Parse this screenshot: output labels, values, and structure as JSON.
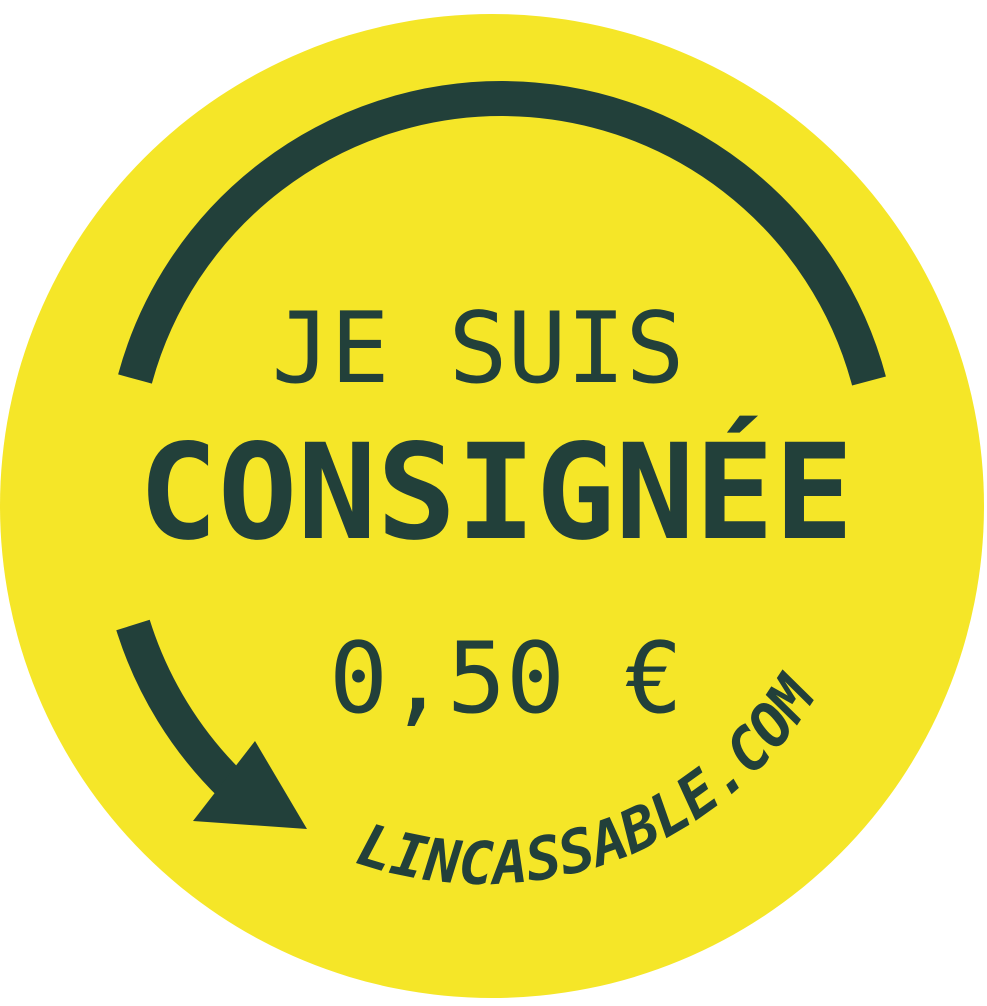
{
  "badge": {
    "line1": "JE SUIS",
    "line2": "CONSIGNÉE",
    "price": "0,50 €",
    "website": "LINCASSABLE.COM"
  },
  "colors": {
    "background": "#ffffff",
    "circle": "#f5e628",
    "ink": "#22403a"
  },
  "icons": {
    "arrow": "circular-arrow-icon"
  }
}
